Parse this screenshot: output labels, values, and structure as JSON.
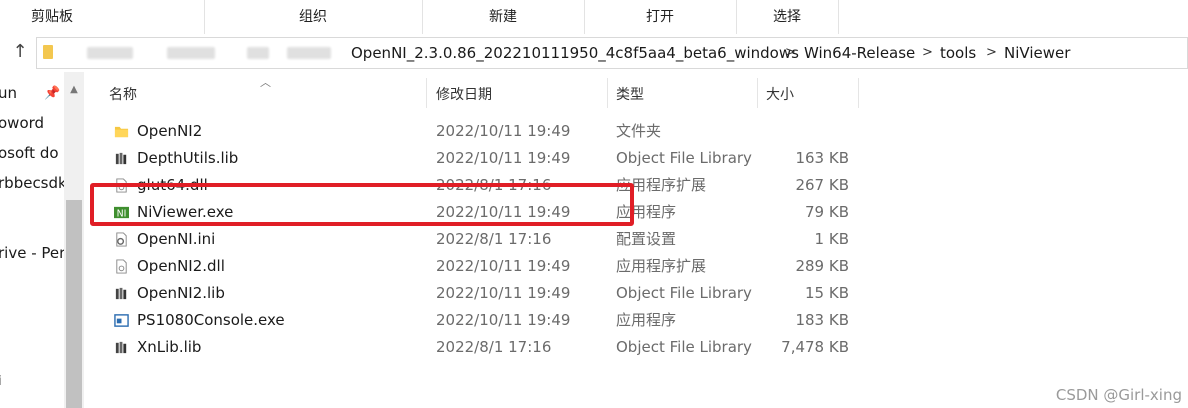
{
  "ribbon": {
    "groups": [
      "剪贴板",
      "组织",
      "新建",
      "打开",
      "选择"
    ]
  },
  "address": {
    "crumbs": [
      "OpenNI_2.3.0.86_202210111950_4c8f5aa4_beta6_windows",
      "Win64-Release",
      "tools",
      "NiViewer"
    ],
    "separator": ">"
  },
  "nav": {
    "items": [
      "un",
      "oword",
      "osoft do",
      "rbbecsdk",
      "rive - Per",
      "i"
    ]
  },
  "columns": {
    "name": "名称",
    "date": "修改日期",
    "type": "类型",
    "size": "大小"
  },
  "files": [
    {
      "name": "OpenNI2",
      "date": "2022/10/11 19:49",
      "type": "文件夹",
      "size": "",
      "icon": "folder-icon"
    },
    {
      "name": "DepthUtils.lib",
      "date": "2022/10/11 19:49",
      "type": "Object File Library",
      "size": "163 KB",
      "icon": "library-file-icon"
    },
    {
      "name": "glut64.dll",
      "date": "2022/8/1 17:16",
      "type": "应用程序扩展",
      "size": "267 KB",
      "icon": "dll-file-icon"
    },
    {
      "name": "NiViewer.exe",
      "date": "2022/10/11 19:49",
      "type": "应用程序",
      "size": "79 KB",
      "icon": "niviewer-app-icon"
    },
    {
      "name": "OpenNI.ini",
      "date": "2022/8/1 17:16",
      "type": "配置设置",
      "size": "1 KB",
      "icon": "ini-file-icon"
    },
    {
      "name": "OpenNI2.dll",
      "date": "2022/10/11 19:49",
      "type": "应用程序扩展",
      "size": "289 KB",
      "icon": "dll-file-icon"
    },
    {
      "name": "OpenNI2.lib",
      "date": "2022/10/11 19:49",
      "type": "Object File Library",
      "size": "15 KB",
      "icon": "library-file-icon"
    },
    {
      "name": "PS1080Console.exe",
      "date": "2022/10/11 19:49",
      "type": "应用程序",
      "size": "183 KB",
      "icon": "console-app-icon"
    },
    {
      "name": "XnLib.lib",
      "date": "2022/8/1 17:16",
      "type": "Object File Library",
      "size": "7,478 KB",
      "icon": "library-file-icon"
    }
  ],
  "highlight_color": "#e01e26",
  "watermark": "CSDN @Girl-xing"
}
